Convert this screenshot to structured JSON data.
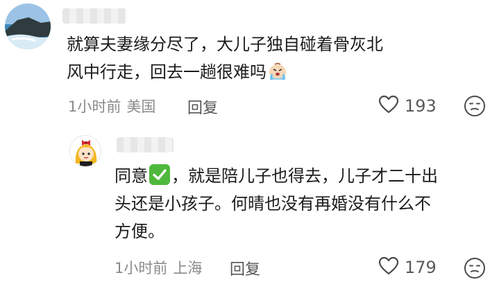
{
  "comments": [
    {
      "text_lines": [
        "就算夫妻缘分尽了，大儿子独自碰着骨灰北",
        "风中行走，回去一趟很难吗"
      ],
      "emoji": "crying-face-emoji",
      "time": "1小时前",
      "location": "美国",
      "reply_label": "回复",
      "likes": "193",
      "avatar": "seaside-rock-photo"
    }
  ],
  "reply": {
    "text_lines": [
      "同意",
      "，就是陪儿子也得去，儿子才二十出",
      "头还是小孩子。何晴也没有再婚没有什么不",
      "方便。"
    ],
    "emoji": "check-mark-emoji",
    "time": "1小时前",
    "location": "上海",
    "reply_label": "回复",
    "likes": "179",
    "avatar": "cartoon-girl-with-red-bow"
  },
  "colors": {
    "text": "#1b1b1b",
    "meta": "#8a8a8a",
    "check_emoji": "#4fb83c"
  }
}
